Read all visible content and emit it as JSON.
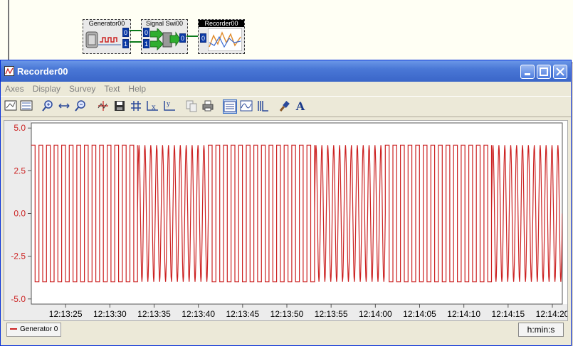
{
  "diagram": {
    "blocks": [
      {
        "title": "Generator00",
        "ports_out": [
          "0",
          "1"
        ]
      },
      {
        "title": "Signal Swi00",
        "ports_in": [
          "0",
          "1"
        ],
        "ports_out": [
          "0"
        ]
      },
      {
        "title": "Recorder00",
        "ports_in": [
          "0"
        ]
      }
    ]
  },
  "window": {
    "title": "Recorder00",
    "min_label": "_",
    "max_label": "□",
    "close_label": "×"
  },
  "menu": [
    "Axes",
    "Display",
    "Survey",
    "Text",
    "Help"
  ],
  "toolbar": [
    {
      "icon": "x-scale-icon"
    },
    {
      "icon": "y-scale-icon"
    },
    {
      "icon": "zoom-in-icon"
    },
    {
      "icon": "pan-icon"
    },
    {
      "icon": "zoom-out-icon"
    },
    {
      "icon": "cursor-icon"
    },
    {
      "icon": "save-icon"
    },
    {
      "icon": "grid-icon"
    },
    {
      "icon": "x-axis-icon"
    },
    {
      "icon": "y-axis-icon"
    },
    {
      "icon": "copy-icon"
    },
    {
      "icon": "print-icon"
    },
    {
      "icon": "strip-mode-icon"
    },
    {
      "icon": "scope-mode-icon"
    },
    {
      "icon": "bars-icon"
    },
    {
      "icon": "color-brush-icon"
    },
    {
      "icon": "font-icon"
    }
  ],
  "chart_data": {
    "type": "line",
    "y_ticks": [
      "5.0",
      "2.5",
      "0.0",
      "-2.5",
      "-5.0"
    ],
    "ylim": [
      -5.3,
      5.3
    ],
    "x_ticks": [
      "12:13:25",
      "12:13:30",
      "12:13:35",
      "12:13:40",
      "12:13:45",
      "12:13:50",
      "12:13:55",
      "12:14:00",
      "12:14:05",
      "12:14:10",
      "12:14:15",
      "12:14:20"
    ],
    "xlim_seconds": [
      0,
      60
    ],
    "signal": {
      "amplitude": 4.0,
      "switch_period_seconds": 20,
      "segments": [
        {
          "from": 0,
          "to": 12,
          "waveform": "square",
          "cycles": 14
        },
        {
          "from": 12,
          "to": 20,
          "waveform": "sine",
          "cycles": 12
        },
        {
          "from": 20,
          "to": 32,
          "waveform": "square",
          "cycles": 14
        },
        {
          "from": 32,
          "to": 40,
          "waveform": "sine",
          "cycles": 12
        },
        {
          "from": 40,
          "to": 52,
          "waveform": "square",
          "cycles": 14
        },
        {
          "from": 52,
          "to": 60,
          "waveform": "sine",
          "cycles": 12
        }
      ]
    },
    "series_color": "#cc2222",
    "legend": "Generator 0",
    "x_units": "h:min:s",
    "grid": false
  }
}
